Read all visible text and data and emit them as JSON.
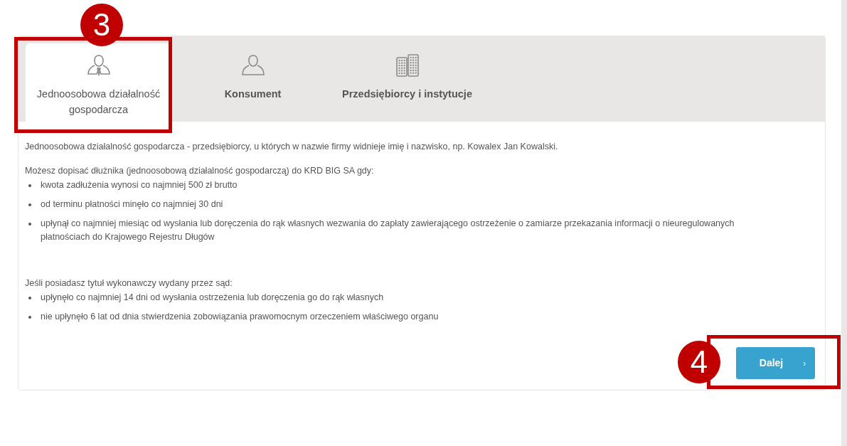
{
  "tabs": [
    {
      "label": "Jednoosobowa działalność gospodarcza",
      "kind": "person-tie",
      "selected": true
    },
    {
      "label": "Konsument",
      "kind": "person",
      "selected": false
    },
    {
      "label": "Przedsiębiorcy i instytucje",
      "kind": "buildings",
      "selected": false
    }
  ],
  "intro": "Jednoosobowa działalność gospodarcza - przedsiębiorcy, u których w nazwie firmy widnieje imię i nazwisko, np. Kowalex Jan Kowalski.",
  "sections": [
    {
      "heading": "Możesz dopisać dłużnika (jednoosobową działalność gospodarczą) do KRD BIG SA gdy:",
      "items": [
        "kwota zadłużenia wynosi co najmniej 500 zł brutto",
        "od terminu płatności minęło co najmniej 30 dni",
        "upłynął co najmniej miesiąc od wysłania lub doręczenia do rąk własnych wezwania do zapłaty zawierającego ostrzeżenie o zamiarze przekazania informacji o nieuregulowanych płatnościach do Krajowego Rejestru Długów"
      ]
    },
    {
      "heading": "Jeśli posiadasz tytuł wykonawczy wydany przez sąd:",
      "items": [
        "upłynęło co najmniej 14 dni od wysłania ostrzeżenia lub doręczenia go do rąk własnych",
        "nie upłynęło 6 lat od dnia stwierdzenia zobowiązania prawomocnym orzeczeniem właściwego organu"
      ]
    }
  ],
  "next_button": {
    "label": "Dalej",
    "chevron": "›"
  },
  "annotations": [
    {
      "number": "3",
      "kind": "tab"
    },
    {
      "number": "4",
      "kind": "button"
    }
  ]
}
